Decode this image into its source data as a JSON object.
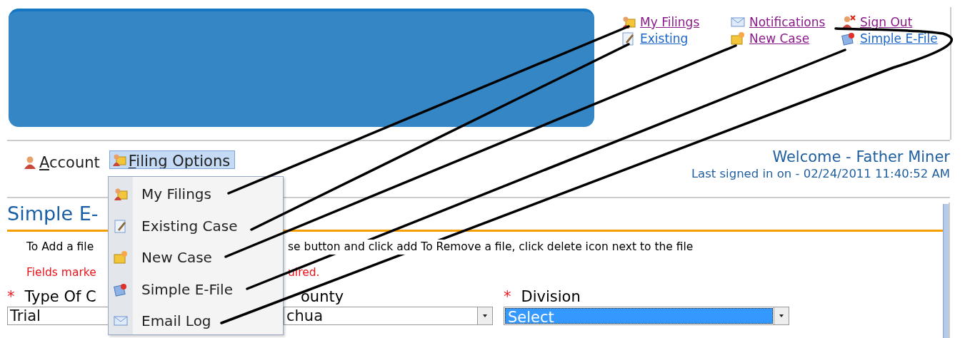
{
  "top_links": [
    {
      "label": "My Filings",
      "visited": true
    },
    {
      "label": "Notifications",
      "visited": true
    },
    {
      "label": "Sign Out",
      "visited": true
    },
    {
      "label": "Existing",
      "visited": false
    },
    {
      "label": "New Case",
      "visited": true
    },
    {
      "label": "Simple E-File",
      "visited": false
    }
  ],
  "nav": [
    {
      "label": "Account",
      "selected": false
    },
    {
      "label": "Filing Options",
      "selected": true
    }
  ],
  "menu": [
    {
      "label": "My Filings"
    },
    {
      "label": "Existing Case"
    },
    {
      "label": "New Case"
    },
    {
      "label": "Simple E-File"
    },
    {
      "label": "Email Log"
    }
  ],
  "welcome": "Welcome - Father Miner",
  "last_signed": "Last signed in on - 02/24/2011 11:40:52 AM",
  "page_title": "Simple E-",
  "instructions": [
    "To Add a file",
    "se button and click add To Remove a file, click delete icon next to the file"
  ],
  "required_note": [
    "Fields marke",
    "uired."
  ],
  "fields": [
    {
      "label": "Type Of C",
      "marker": "*",
      "value": "Trial",
      "focused": false
    },
    {
      "label": "ounty",
      "value": "chua",
      "focused": false,
      "arrow": true
    },
    {
      "label": "Division",
      "marker": "*",
      "value": "Select",
      "focused": true,
      "arrow": true
    }
  ]
}
